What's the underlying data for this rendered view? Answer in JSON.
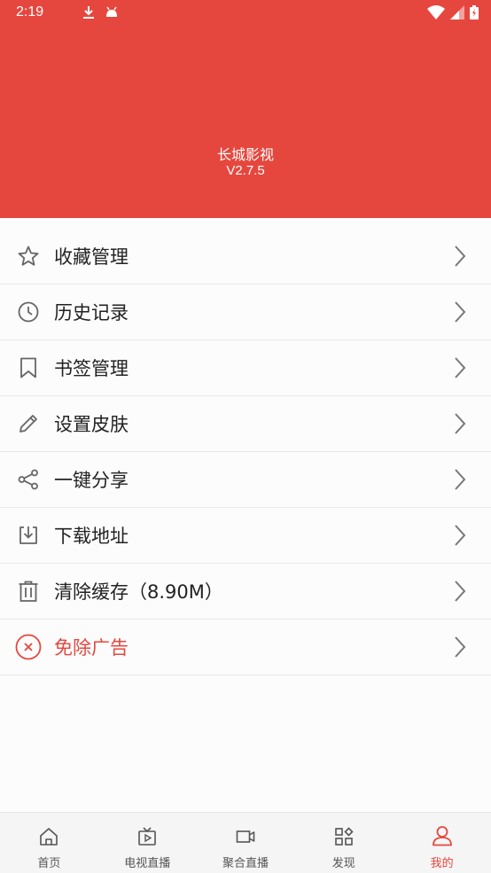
{
  "status_bar": {
    "time": "2:19",
    "left_icons": [
      "download-icon",
      "android-icon"
    ],
    "right_icons": [
      "wifi-icon",
      "signal-icon",
      "battery-icon"
    ]
  },
  "header": {
    "title": "长城影视",
    "version": "V2.7.5",
    "background_color": "#e5473e"
  },
  "menu": {
    "items": [
      {
        "label": "收藏管理",
        "icon": "star-icon"
      },
      {
        "label": "历史记录",
        "icon": "clock-icon"
      },
      {
        "label": "书签管理",
        "icon": "bookmark-icon"
      },
      {
        "label": "设置皮肤",
        "icon": "pencil-icon"
      },
      {
        "label": "一键分享",
        "icon": "share-icon"
      },
      {
        "label": "下载地址",
        "icon": "download-box-icon"
      },
      {
        "label": "清除缓存（8.90M）",
        "icon": "trash-icon"
      },
      {
        "label": "免除广告",
        "icon": "close-circle-icon",
        "accent_color": "#e5473e"
      }
    ]
  },
  "tabbar": {
    "tabs": [
      {
        "label": "首页",
        "icon": "home-icon",
        "active": false
      },
      {
        "label": "电视直播",
        "icon": "tv-icon",
        "active": false
      },
      {
        "label": "聚合直播",
        "icon": "video-icon",
        "active": false
      },
      {
        "label": "发现",
        "icon": "apps-icon",
        "active": false
      },
      {
        "label": "我的",
        "icon": "user-icon",
        "active": true
      }
    ],
    "active_color": "#e5473e"
  }
}
